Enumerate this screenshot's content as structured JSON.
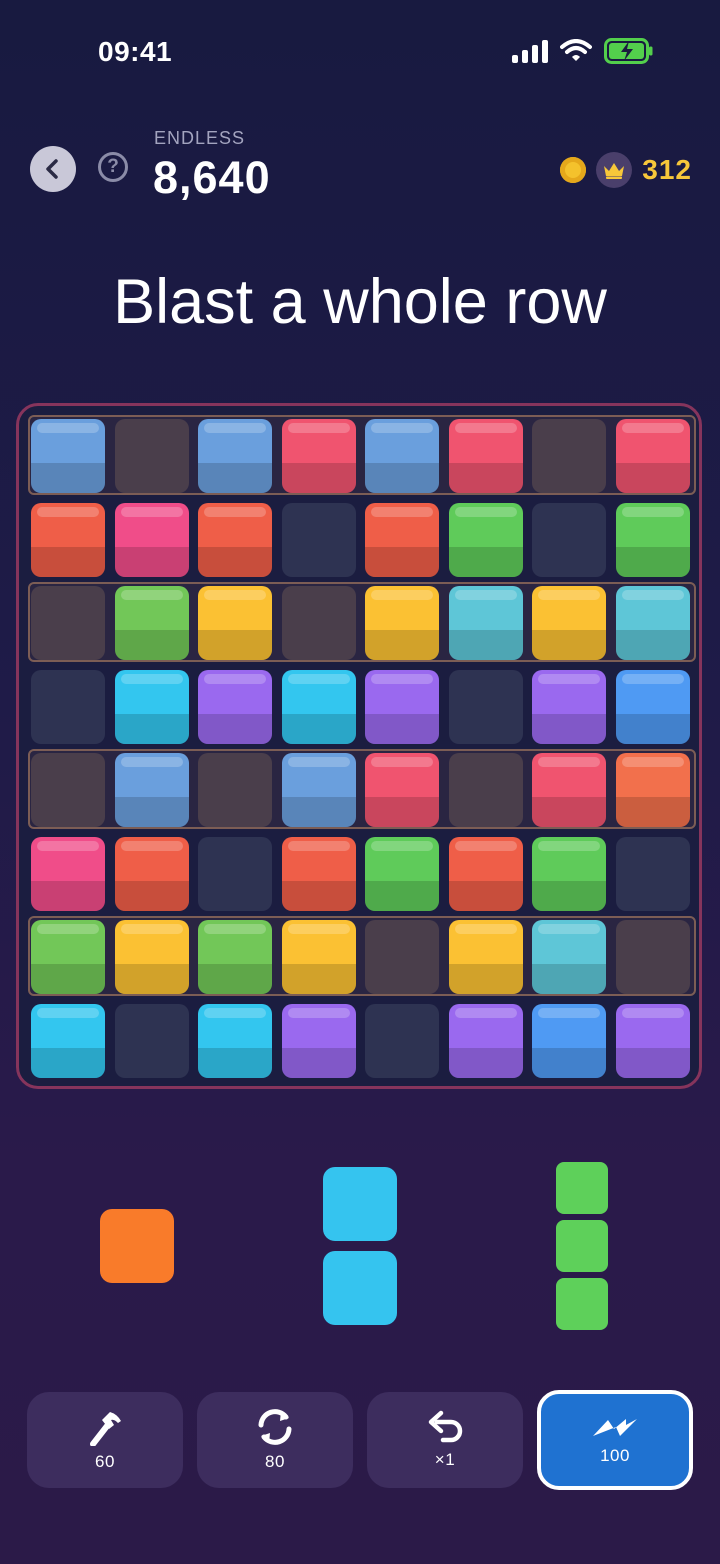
{
  "status_bar": {
    "time": "09:41"
  },
  "header": {
    "mode_label": "ENDLESS",
    "score": "8,640",
    "crowns": "312"
  },
  "instruction": "Blast a whole row",
  "board": {
    "highlighted_rows": [
      0,
      2,
      4,
      6
    ],
    "palette": {
      "blue": "#6a9fdd",
      "red": "#f0546f",
      "orange": "#ef5e48",
      "pink": "#f04d89",
      "green": "#5fcb5a",
      "yellow": "#fbc133",
      "teal": "#5ec6d7",
      "cyan": "#33c6ef",
      "purple": "#9a69ef",
      "sky": "#4f9af3",
      "lime": "#72c758",
      "coral": "#f2704c"
    },
    "rows": [
      [
        "blue",
        "E",
        "blue",
        "red",
        "blue",
        "red",
        "E",
        "red"
      ],
      [
        "orange",
        "pink",
        "orange",
        "D",
        "orange",
        "green",
        "D",
        "green"
      ],
      [
        "E",
        "lime",
        "yellow",
        "E",
        "yellow",
        "teal",
        "yellow",
        "teal"
      ],
      [
        "D",
        "cyan",
        "purple",
        "cyan",
        "purple",
        "D",
        "purple",
        "sky"
      ],
      [
        "E",
        "blue",
        "E",
        "blue",
        "red",
        "E",
        "red",
        "coral"
      ],
      [
        "pink",
        "orange",
        "D",
        "orange",
        "green",
        "orange",
        "green",
        "D"
      ],
      [
        "lime",
        "yellow",
        "lime",
        "yellow",
        "E",
        "yellow",
        "teal",
        "E"
      ],
      [
        "cyan",
        "D",
        "cyan",
        "purple",
        "D",
        "purple",
        "sky",
        "purple"
      ]
    ]
  },
  "pieces": [
    {
      "name": "single-orange",
      "color": "#f97b2a",
      "cells": 1
    },
    {
      "name": "vertical-2-cyan",
      "color": "#35c4ef",
      "cells": 2
    },
    {
      "name": "vertical-3-green",
      "color": "#5ed05a",
      "cells": 3
    }
  ],
  "powerups": [
    {
      "name": "hammer",
      "icon": "hammer-icon",
      "count": "60",
      "active": false
    },
    {
      "name": "shuffle",
      "icon": "refresh-icon",
      "count": "80",
      "active": false
    },
    {
      "name": "undo",
      "icon": "undo-icon",
      "count": "×1",
      "active": false
    },
    {
      "name": "zap",
      "icon": "zigzag-icon",
      "count": "100",
      "active": true
    }
  ]
}
